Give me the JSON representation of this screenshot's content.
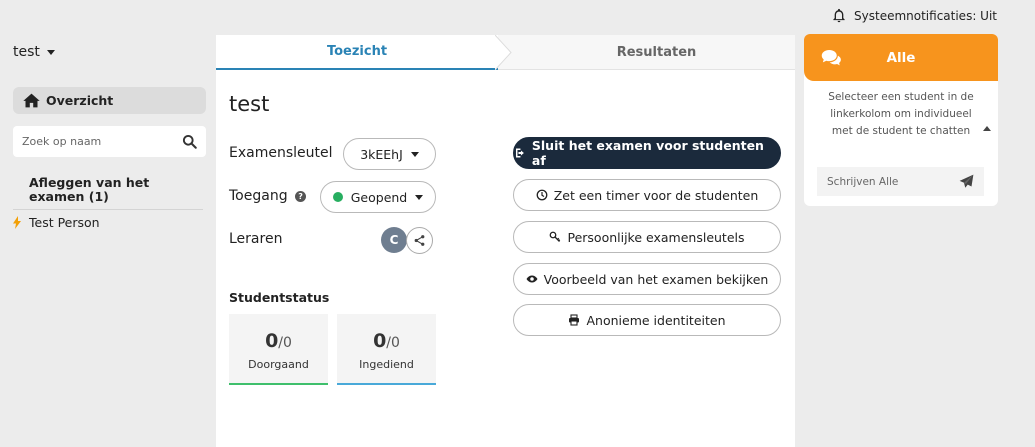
{
  "header": {
    "notifications_label": "Systeemnotificaties: Uit"
  },
  "sidebar": {
    "exam_selector": "test",
    "overview_label": "Overzicht",
    "search_placeholder": "Zoek op naam",
    "group_title": "Afleggen van het examen (1)",
    "students": [
      {
        "name": "Test Person"
      }
    ]
  },
  "main": {
    "tabs": [
      {
        "label": "Toezicht"
      },
      {
        "label": "Resultaten"
      }
    ],
    "exam_title": "test",
    "exam_key_label": "Examensleutel",
    "exam_key_value": "3kEEhJ",
    "access_label": "Toegang",
    "access_value": "Geopend",
    "teachers_label": "Leraren",
    "teacher_initial": "C",
    "student_status_title": "Studentstatus",
    "stats": [
      {
        "value": "0",
        "total": "/0",
        "label": "Doorgaand"
      },
      {
        "value": "0",
        "total": "/0",
        "label": "Ingediend"
      }
    ],
    "actions": {
      "close_exam": "Sluit het examen voor studenten af",
      "set_timer": "Zet een timer voor de studenten",
      "personal_keys": "Persoonlijke examensleutels",
      "preview": "Voorbeeld van het examen bekijken",
      "anonymous": "Anonieme identiteiten"
    }
  },
  "chat": {
    "title": "Alle",
    "info": "Selecteer een student in de linkerkolom om individueel met de student te chatten",
    "input_placeholder": "Schrijven Alle"
  },
  "colors": {
    "accent": "#2a83b5",
    "chat": "#f7941d",
    "dark_button": "#1b2a3c",
    "status_open": "#27ae60"
  }
}
